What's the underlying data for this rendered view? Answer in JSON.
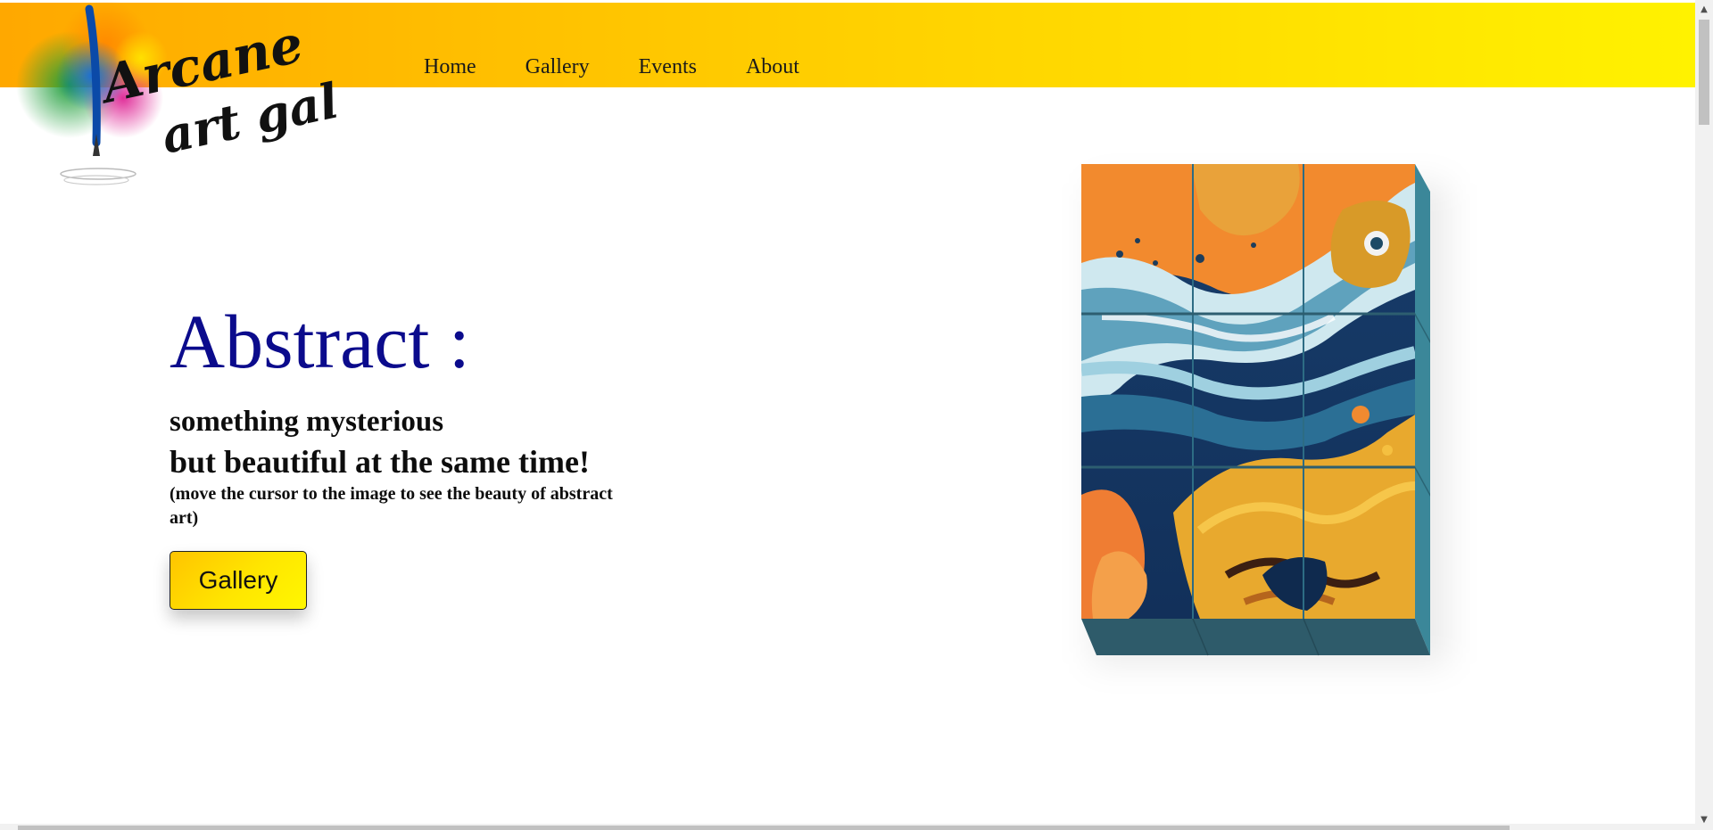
{
  "nav": {
    "items": [
      "Home",
      "Gallery",
      "Events",
      "About"
    ]
  },
  "logo": {
    "line1": "Arcane",
    "line2": "art gallery"
  },
  "hero": {
    "title": "Abstract :",
    "tagline_line1": "something mysterious",
    "tagline_line2": "but beautiful at the same time!",
    "hint": "(move the cursor to the image to see the beauty of abstract art)",
    "button_label": "Gallery"
  },
  "colors": {
    "header_start": "#ffa800",
    "header_end": "#fff200",
    "title": "#0b0b8c",
    "cube_side": "#2e5b6a"
  },
  "icons": {
    "scroll_up": "▲",
    "scroll_down": "▼"
  }
}
